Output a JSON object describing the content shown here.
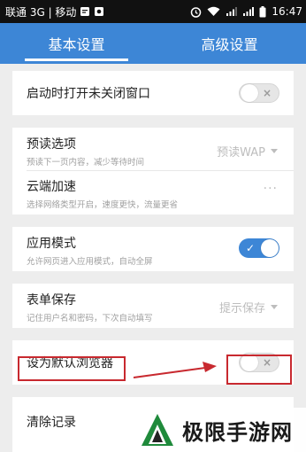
{
  "status_bar": {
    "carrier_text": "联通 3G | 移动",
    "time": "16:47",
    "icons": [
      "sms-icon",
      "image-icon",
      "alarm-icon",
      "wifi-icon",
      "signal-icon",
      "signal-icon",
      "battery-icon"
    ]
  },
  "tabs": [
    {
      "label": "基本设置",
      "active": true
    },
    {
      "label": "高级设置",
      "active": false
    }
  ],
  "settings": {
    "restore_windows": {
      "title": "启动时打开未关闭窗口",
      "enabled": false
    },
    "preread": {
      "title": "预读选项",
      "desc": "预读下一页内容，减少等待时间",
      "value": "预读WAP"
    },
    "cloud": {
      "title": "云端加速",
      "desc": "选择网络类型开启，速度更快，流量更省",
      "value": "···"
    },
    "app_mode": {
      "title": "应用模式",
      "desc": "允许网页进入应用模式，自动全屏",
      "enabled": true
    },
    "form_save": {
      "title": "表单保存",
      "desc": "记住用户名和密码，下次自动填写",
      "value": "提示保存"
    },
    "default_browser": {
      "title": "设为默认浏览器",
      "enabled": false
    },
    "clear": {
      "title": "清除记录"
    }
  },
  "toggle_marks": {
    "on": "✓",
    "off": "×"
  },
  "annotation": {
    "color": "#c8292f"
  },
  "watermark": {
    "text": "极限手游网"
  },
  "colors": {
    "accent": "#3d86d6",
    "background": "#ededed",
    "annotation_red": "#c8292f"
  }
}
